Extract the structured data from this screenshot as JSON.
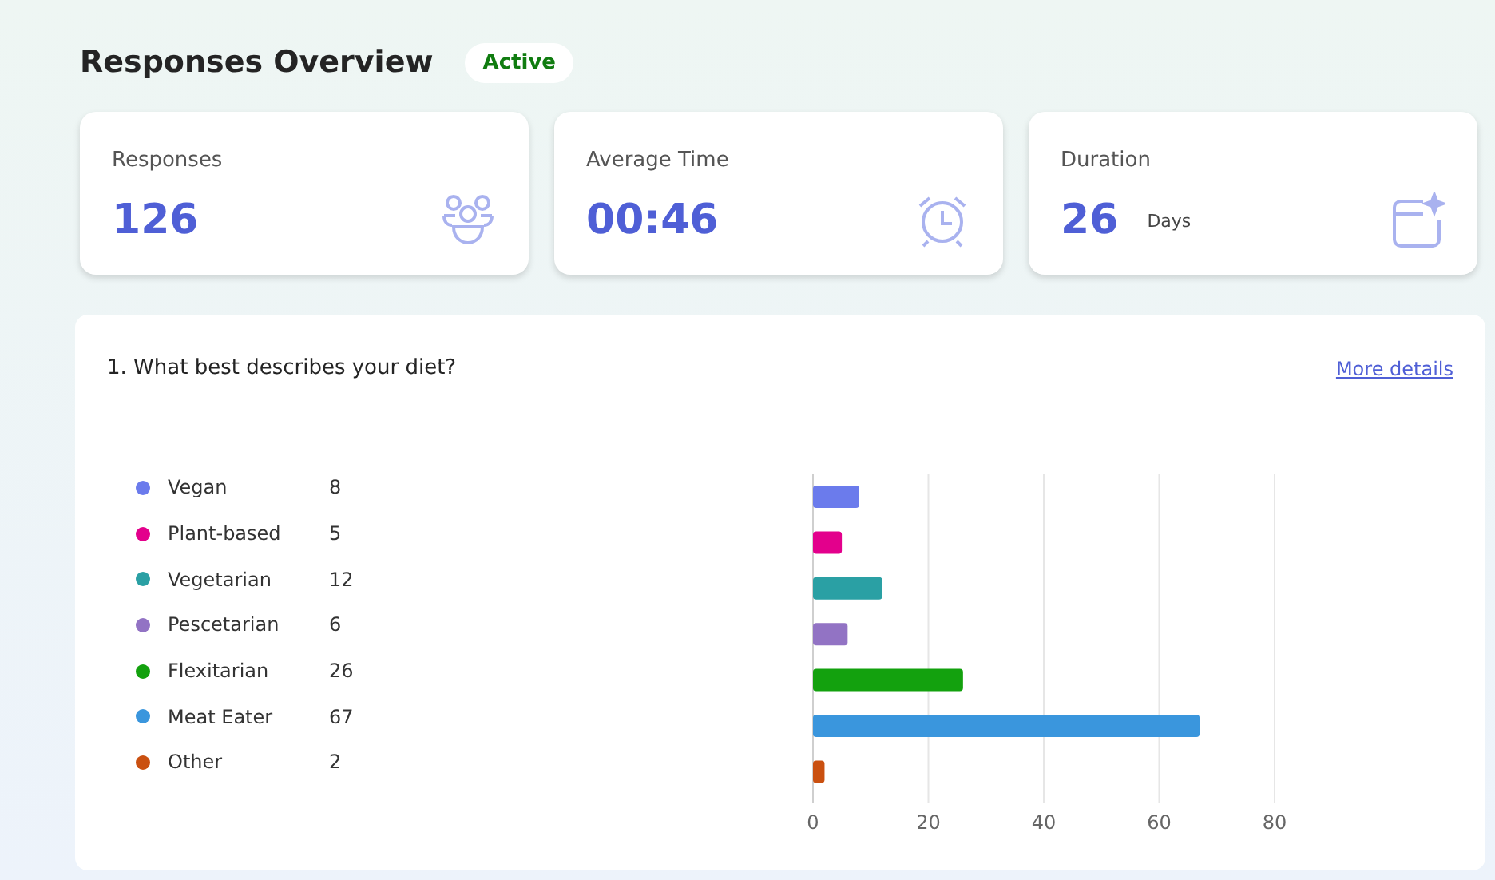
{
  "header": {
    "title": "Responses Overview",
    "status": "Active"
  },
  "stats": [
    {
      "kind": "people",
      "label": "Responses",
      "value": "126"
    },
    {
      "kind": "clock",
      "label": "Average Time",
      "value": "00:46"
    },
    {
      "kind": "calendar",
      "label": "Duration",
      "value": "26",
      "unit": "Days"
    }
  ],
  "question": {
    "title": "1. What best describes your diet?",
    "link": "More details",
    "legend": [
      {
        "label": "Vegan",
        "count": "8",
        "color": "#6b7bec"
      },
      {
        "label": "Plant-based",
        "count": "5",
        "color": "#e3008c"
      },
      {
        "label": "Vegetarian",
        "count": "12",
        "color": "#2aa0a4"
      },
      {
        "label": "Pescetarian",
        "count": "6",
        "color": "#9273c4"
      },
      {
        "label": "Flexitarian",
        "count": "26",
        "color": "#13a10e"
      },
      {
        "label": "Meat Eater",
        "count": "67",
        "color": "#3a96dd"
      },
      {
        "label": "Other",
        "count": "2",
        "color": "#ca5010"
      }
    ],
    "chart_data": {
      "type": "bar",
      "orientation": "horizontal",
      "grid": true,
      "values": [
        8,
        5,
        12,
        6,
        26,
        67,
        2
      ],
      "xlim": [
        0,
        80
      ],
      "xticks": [
        0,
        20,
        40,
        60,
        80
      ]
    }
  }
}
